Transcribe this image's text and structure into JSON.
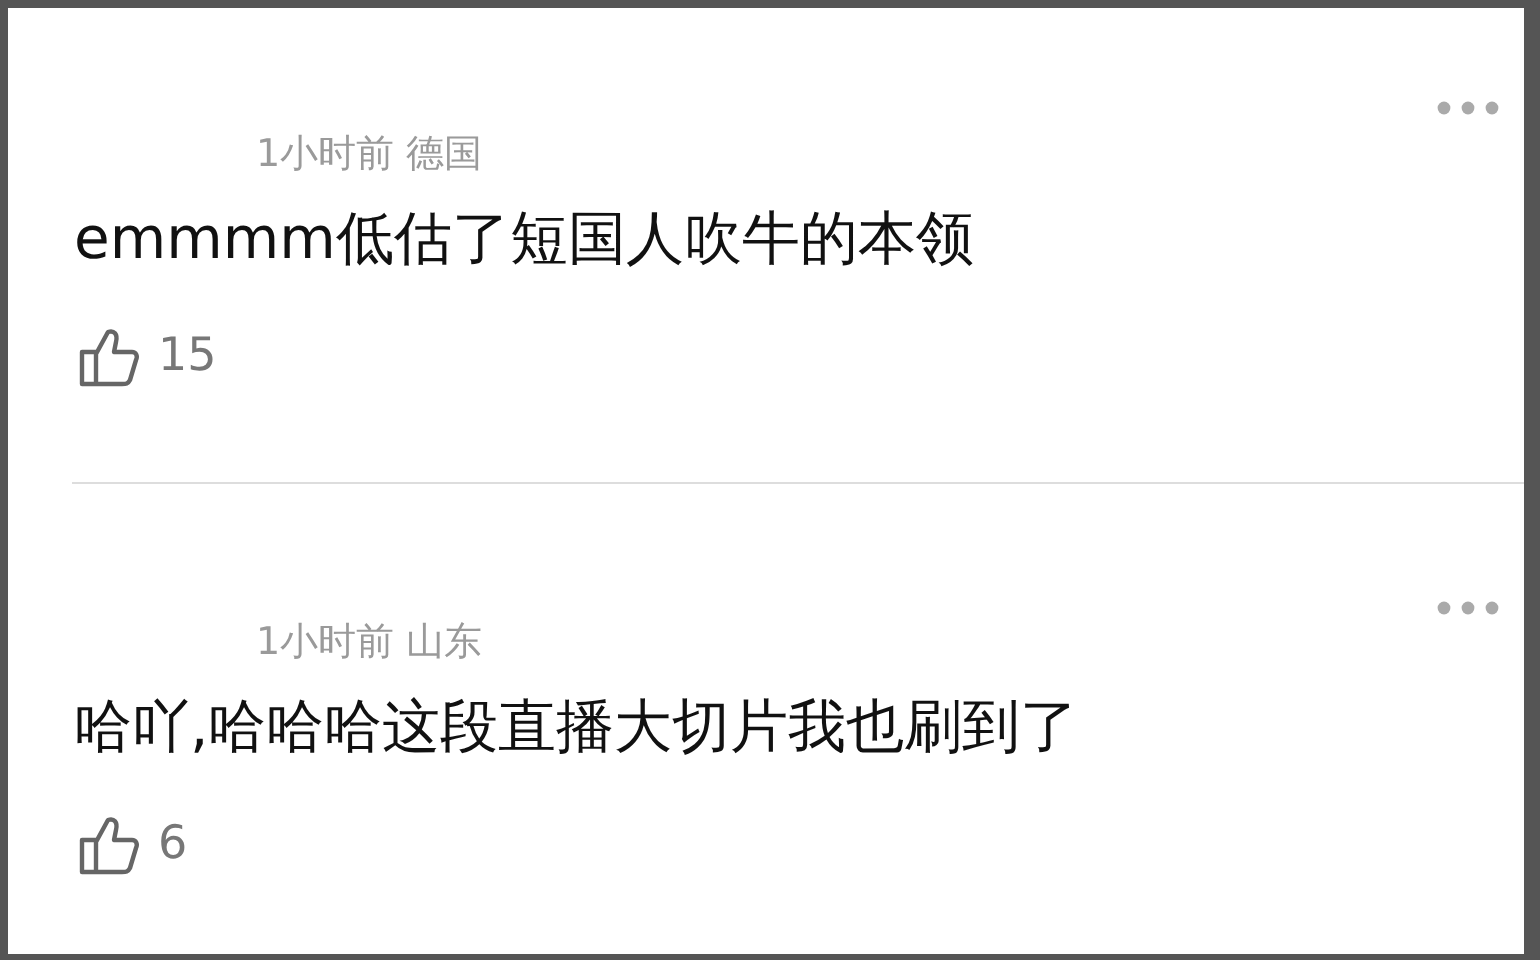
{
  "comments": [
    {
      "time": "1小时前",
      "location": "德国",
      "text": "emmmm低估了短国人吹牛的本领",
      "likes": "15"
    },
    {
      "time": "1小时前",
      "location": "山东",
      "text": "哈吖,哈哈哈这段直播大切片我也刷到了",
      "likes": "6"
    }
  ]
}
